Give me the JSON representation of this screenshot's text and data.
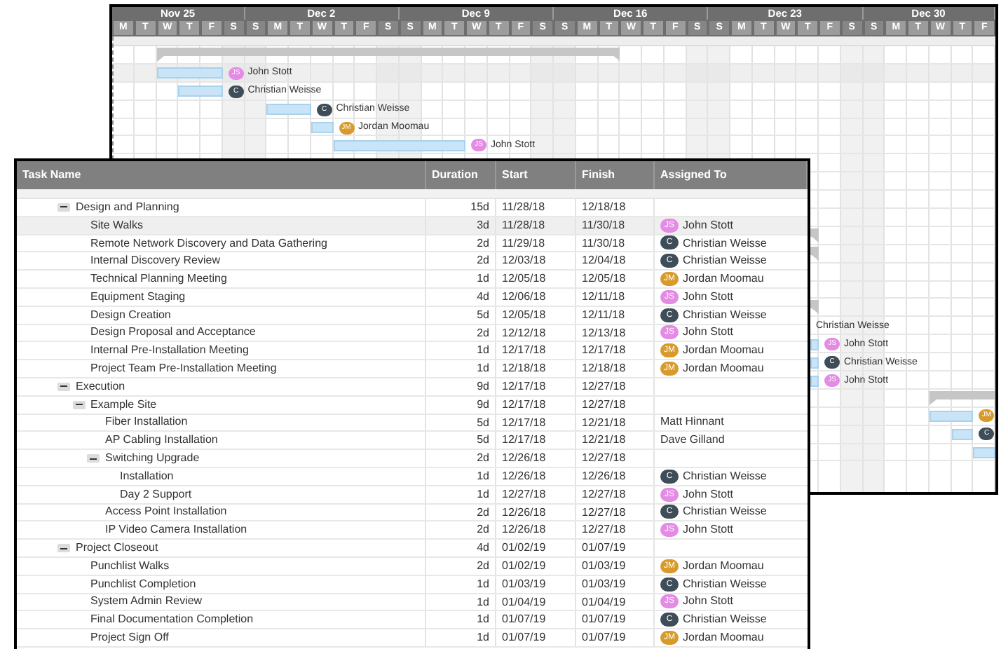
{
  "gantt": {
    "weeks": [
      {
        "label": "Nov 25",
        "days": [
          {
            "letter": "M",
            "weekend": false
          },
          {
            "letter": "T",
            "weekend": false
          },
          {
            "letter": "W",
            "weekend": false
          },
          {
            "letter": "T",
            "weekend": false
          },
          {
            "letter": "F",
            "weekend": false
          },
          {
            "letter": "S",
            "weekend": true
          }
        ]
      },
      {
        "label": "Dec 2",
        "days": [
          {
            "letter": "S",
            "weekend": true
          },
          {
            "letter": "M",
            "weekend": false
          },
          {
            "letter": "T",
            "weekend": false
          },
          {
            "letter": "W",
            "weekend": false
          },
          {
            "letter": "T",
            "weekend": false
          },
          {
            "letter": "F",
            "weekend": false
          },
          {
            "letter": "S",
            "weekend": true
          }
        ]
      },
      {
        "label": "Dec 9",
        "days": [
          {
            "letter": "S",
            "weekend": true
          },
          {
            "letter": "M",
            "weekend": false
          },
          {
            "letter": "T",
            "weekend": false
          },
          {
            "letter": "W",
            "weekend": false
          },
          {
            "letter": "T",
            "weekend": false
          },
          {
            "letter": "F",
            "weekend": false
          },
          {
            "letter": "S",
            "weekend": true
          }
        ]
      },
      {
        "label": "Dec 16",
        "days": [
          {
            "letter": "S",
            "weekend": true
          },
          {
            "letter": "M",
            "weekend": false
          },
          {
            "letter": "T",
            "weekend": false
          },
          {
            "letter": "W",
            "weekend": false
          },
          {
            "letter": "T",
            "weekend": false
          },
          {
            "letter": "F",
            "weekend": false
          },
          {
            "letter": "S",
            "weekend": true
          }
        ]
      },
      {
        "label": "Dec 23",
        "days": [
          {
            "letter": "S",
            "weekend": true
          },
          {
            "letter": "M",
            "weekend": false
          },
          {
            "letter": "T",
            "weekend": false
          },
          {
            "letter": "W",
            "weekend": false
          },
          {
            "letter": "T",
            "weekend": false
          },
          {
            "letter": "F",
            "weekend": false
          },
          {
            "letter": "S",
            "weekend": true
          }
        ]
      },
      {
        "label": "Dec 30",
        "days": [
          {
            "letter": "S",
            "weekend": true
          },
          {
            "letter": "M",
            "weekend": false
          },
          {
            "letter": "T",
            "weekend": false
          },
          {
            "letter": "W",
            "weekend": false
          },
          {
            "letter": "T",
            "weekend": false
          },
          {
            "letter": "F",
            "weekend": false
          }
        ]
      }
    ],
    "rows": [
      {
        "kind": "summary"
      },
      {
        "kind": "task",
        "selected": true,
        "assignee": {
          "initials": "JS",
          "name": "John Stott",
          "color": "#e48be4"
        }
      },
      {
        "kind": "task",
        "selected": false,
        "assignee": {
          "initials": "C",
          "name": "Christian Weisse",
          "color": "#3e4d58"
        }
      },
      {
        "kind": "task",
        "selected": false,
        "assignee": {
          "initials": "C",
          "name": "Christian Weisse",
          "color": "#3e4d58"
        }
      },
      {
        "kind": "task",
        "selected": false,
        "assignee": {
          "initials": "JM",
          "name": "Jordan Moomau",
          "color": "#d89b2b"
        }
      },
      {
        "kind": "task",
        "selected": false,
        "assignee": {
          "initials": "JS",
          "name": "John Stott",
          "color": "#e48be4"
        }
      },
      {
        "kind": "empty"
      },
      {
        "kind": "empty"
      },
      {
        "kind": "empty"
      },
      {
        "kind": "empty"
      },
      {
        "kind": "summary"
      },
      {
        "kind": "summary"
      },
      {
        "kind": "empty"
      },
      {
        "kind": "empty"
      },
      {
        "kind": "summary"
      },
      {
        "kind": "task",
        "selected": false,
        "assignee": {
          "name": "Christian Weisse"
        }
      },
      {
        "kind": "task",
        "selected": false,
        "assignee": {
          "initials": "JS",
          "name": "John Stott",
          "color": "#e48be4"
        }
      },
      {
        "kind": "task",
        "selected": false,
        "assignee": {
          "initials": "C",
          "name": "Christian Weisse",
          "color": "#3e4d58"
        }
      },
      {
        "kind": "task",
        "selected": false,
        "assignee": {
          "initials": "JS",
          "name": "John Stott",
          "color": "#e48be4"
        }
      },
      {
        "kind": "summary"
      },
      {
        "kind": "task",
        "selected": false,
        "assignee": {
          "initials": "JM",
          "color": "#d89b2b"
        }
      },
      {
        "kind": "task",
        "selected": false,
        "assignee": {
          "initials": "C",
          "color": "#3e4d58"
        }
      },
      {
        "kind": "task",
        "selected": false
      }
    ]
  },
  "grid": {
    "columns": [
      "Task Name",
      "Duration",
      "Start",
      "Finish",
      "Assigned To"
    ],
    "rows": [
      {
        "name": "Design and Planning",
        "duration": "15d",
        "start": "11/28/18",
        "finish": "12/18/18",
        "expanded": true,
        "selected": false,
        "children": [
          {
            "name": "Site Walks",
            "duration": "3d",
            "start": "11/28/18",
            "finish": "11/30/18",
            "selected": true,
            "assigned_to": {
              "initials": "JS",
              "name": "John Stott",
              "color": "#e48be4"
            }
          },
          {
            "name": "Remote Network Discovery and Data Gathering",
            "duration": "2d",
            "start": "11/29/18",
            "finish": "11/30/18",
            "selected": false,
            "assigned_to": {
              "initials": "C",
              "name": "Christian Weisse",
              "color": "#3e4d58"
            }
          },
          {
            "name": "Internal Discovery Review",
            "duration": "2d",
            "start": "12/03/18",
            "finish": "12/04/18",
            "selected": false,
            "assigned_to": {
              "initials": "C",
              "name": "Christian Weisse",
              "color": "#3e4d58"
            }
          },
          {
            "name": "Technical Planning Meeting",
            "duration": "1d",
            "start": "12/05/18",
            "finish": "12/05/18",
            "selected": false,
            "assigned_to": {
              "initials": "JM",
              "name": "Jordan Moomau",
              "color": "#d89b2b"
            }
          },
          {
            "name": "Equipment Staging",
            "duration": "4d",
            "start": "12/06/18",
            "finish": "12/11/18",
            "selected": false,
            "assigned_to": {
              "initials": "JS",
              "name": "John Stott",
              "color": "#e48be4"
            }
          },
          {
            "name": "Design Creation",
            "duration": "5d",
            "start": "12/05/18",
            "finish": "12/11/18",
            "selected": false,
            "assigned_to": {
              "initials": "C",
              "name": "Christian Weisse",
              "color": "#3e4d58"
            }
          },
          {
            "name": "Design Proposal and Acceptance",
            "duration": "2d",
            "start": "12/12/18",
            "finish": "12/13/18",
            "selected": false,
            "assigned_to": {
              "initials": "JS",
              "name": "John Stott",
              "color": "#e48be4"
            }
          },
          {
            "name": "Internal Pre-Installation Meeting",
            "duration": "1d",
            "start": "12/17/18",
            "finish": "12/17/18",
            "selected": false,
            "assigned_to": {
              "initials": "JM",
              "name": "Jordan Moomau",
              "color": "#d89b2b"
            }
          },
          {
            "name": "Project Team Pre-Installation Meeting",
            "duration": "1d",
            "start": "12/18/18",
            "finish": "12/18/18",
            "selected": false,
            "assigned_to": {
              "initials": "JM",
              "name": "Jordan Moomau",
              "color": "#d89b2b"
            }
          }
        ]
      },
      {
        "name": "Execution",
        "duration": "9d",
        "start": "12/17/18",
        "finish": "12/27/18",
        "expanded": true,
        "selected": false,
        "children": [
          {
            "name": "Example Site",
            "duration": "9d",
            "start": "12/17/18",
            "finish": "12/27/18",
            "expanded": true,
            "selected": false,
            "children": [
              {
                "name": "Fiber Installation",
                "duration": "5d",
                "start": "12/17/18",
                "finish": "12/21/18",
                "selected": false,
                "assigned_to": {
                  "name": "Matt Hinnant"
                }
              },
              {
                "name": "AP Cabling Installation",
                "duration": "5d",
                "start": "12/17/18",
                "finish": "12/21/18",
                "selected": false,
                "assigned_to": {
                  "name": "Dave Gilland"
                }
              },
              {
                "name": "Switching Upgrade",
                "duration": "2d",
                "start": "12/26/18",
                "finish": "12/27/18",
                "expanded": true,
                "selected": false,
                "children": [
                  {
                    "name": "Installation",
                    "duration": "1d",
                    "start": "12/26/18",
                    "finish": "12/26/18",
                    "selected": false,
                    "assigned_to": {
                      "initials": "C",
                      "name": "Christian Weisse",
                      "color": "#3e4d58"
                    }
                  },
                  {
                    "name": "Day 2 Support",
                    "duration": "1d",
                    "start": "12/27/18",
                    "finish": "12/27/18",
                    "selected": false,
                    "assigned_to": {
                      "initials": "JS",
                      "name": "John Stott",
                      "color": "#e48be4"
                    }
                  }
                ]
              },
              {
                "name": "Access Point Installation",
                "duration": "2d",
                "start": "12/26/18",
                "finish": "12/27/18",
                "selected": false,
                "assigned_to": {
                  "initials": "C",
                  "name": "Christian Weisse",
                  "color": "#3e4d58"
                }
              },
              {
                "name": "IP Video Camera Installation",
                "duration": "2d",
                "start": "12/26/18",
                "finish": "12/27/18",
                "selected": false,
                "assigned_to": {
                  "initials": "JS",
                  "name": "John Stott",
                  "color": "#e48be4"
                }
              }
            ]
          }
        ]
      },
      {
        "name": "Project Closeout",
        "duration": "4d",
        "start": "01/02/19",
        "finish": "01/07/19",
        "expanded": true,
        "selected": false,
        "children": [
          {
            "name": "Punchlist Walks",
            "duration": "2d",
            "start": "01/02/19",
            "finish": "01/03/19",
            "selected": false,
            "assigned_to": {
              "initials": "JM",
              "name": "Jordan Moomau",
              "color": "#d89b2b"
            }
          },
          {
            "name": "Punchlist Completion",
            "duration": "1d",
            "start": "01/03/19",
            "finish": "01/03/19",
            "selected": false,
            "assigned_to": {
              "initials": "C",
              "name": "Christian Weisse",
              "color": "#3e4d58"
            }
          },
          {
            "name": "System Admin Review",
            "duration": "1d",
            "start": "01/04/19",
            "finish": "01/04/19",
            "selected": false,
            "assigned_to": {
              "initials": "JS",
              "name": "John Stott",
              "color": "#e48be4"
            }
          },
          {
            "name": "Final Documentation Completion",
            "duration": "1d",
            "start": "01/07/19",
            "finish": "01/07/19",
            "selected": false,
            "assigned_to": {
              "initials": "C",
              "name": "Christian Weisse",
              "color": "#3e4d58"
            }
          },
          {
            "name": "Project Sign Off",
            "duration": "1d",
            "start": "01/07/19",
            "finish": "01/07/19",
            "selected": false,
            "assigned_to": {
              "initials": "JM",
              "name": "Jordan Moomau",
              "color": "#d89b2b"
            }
          }
        ]
      }
    ]
  }
}
